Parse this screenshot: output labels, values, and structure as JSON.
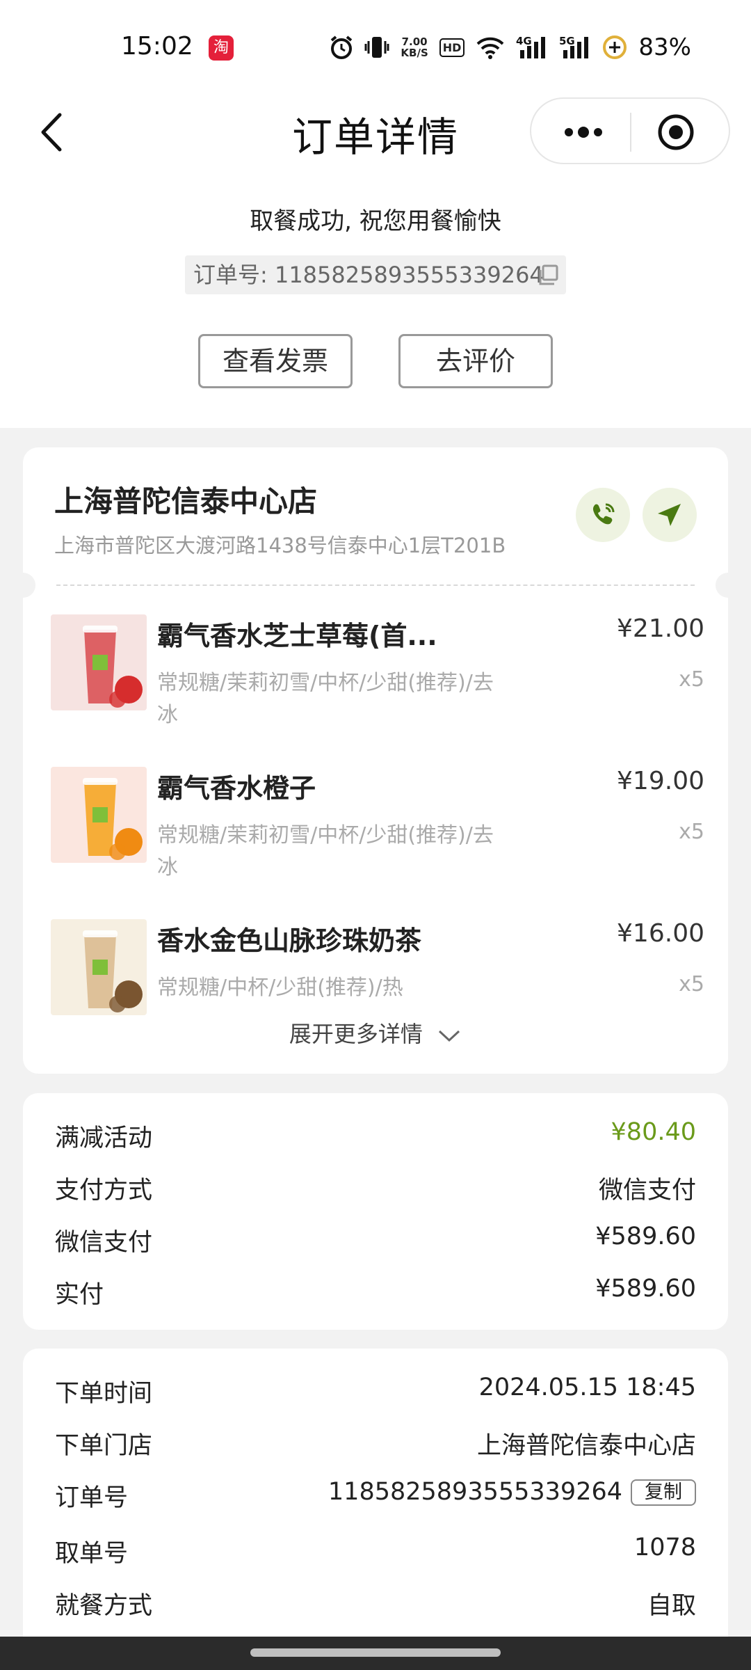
{
  "status_bar": {
    "time": "15:02",
    "app_badge": "淘",
    "net_speed_value": "7.00",
    "net_speed_unit": "KB/S",
    "hd_label": "HD",
    "net_4g": "4G",
    "net_5g": "5G",
    "battery": "83%",
    "icons": [
      "alarm-icon",
      "vibrate-icon",
      "wifi-icon",
      "signal-icon",
      "battery-icon"
    ]
  },
  "nav": {
    "title": "订单详情",
    "back_icon": "chevron-left-icon",
    "more_icon": "more-dots-icon",
    "close_icon": "target-circle-icon"
  },
  "header": {
    "success_message": "取餐成功, 祝您用餐愉快",
    "order_number_label": "订单号: 1185825893555339264",
    "invoice_button": "查看发票",
    "review_button": "去评价"
  },
  "store": {
    "name": "上海普陀信泰中心店",
    "address": "上海市普陀区大渡河路1438号信泰中心1层T201B",
    "actions": [
      "phone-icon",
      "navigate-icon"
    ]
  },
  "items": [
    {
      "name": "霸气香水芝士草莓(首...",
      "options": "常规糖/茉莉初雪/中杯/少甜(推荐)/去冰",
      "price": "¥21.00",
      "qty": "x5",
      "thumb_bg": "#f6e3e1",
      "drink_color": "#d84a4e",
      "fruit_color": "#d62d2d"
    },
    {
      "name": "霸气香水橙子",
      "options": "常规糖/茉莉初雪/中杯/少甜(推荐)/去冰",
      "price": "¥19.00",
      "qty": "x5",
      "thumb_bg": "#fbe6df",
      "drink_color": "#f5a21b",
      "fruit_color": "#f08b12"
    },
    {
      "name": "香水金色山脉珍珠奶茶",
      "options": "常规糖/中杯/少甜(推荐)/热",
      "price": "¥16.00",
      "qty": "x5",
      "thumb_bg": "#f6efe1",
      "drink_color": "#d9b98c",
      "fruit_color": "#7a5530"
    }
  ],
  "expand_label": "展开更多详情",
  "payment": {
    "rows": [
      {
        "label": "满减活动",
        "value": "¥80.40",
        "highlight": true
      },
      {
        "label": "支付方式",
        "value": "微信支付"
      },
      {
        "label": "微信支付",
        "value": "¥589.60"
      },
      {
        "label": "实付",
        "value": "¥589.60"
      }
    ]
  },
  "order_info": {
    "rows": [
      {
        "label": "下单时间",
        "value": "2024.05.15 18:45"
      },
      {
        "label": "下单门店",
        "value": "上海普陀信泰中心店"
      },
      {
        "label": "订单号",
        "value": "1185825893555339264",
        "copy_label": "复制"
      },
      {
        "label": "取单号",
        "value": "1078"
      },
      {
        "label": "就餐方式",
        "value": "自取"
      }
    ]
  },
  "colors": {
    "accent_green": "#6a9a1a",
    "circle_button_bg": "#eef3e1",
    "icon_green": "#4a7a12"
  }
}
